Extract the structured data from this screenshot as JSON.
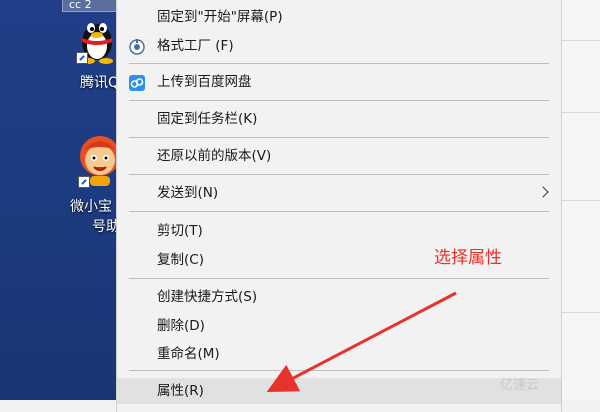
{
  "desktop": {
    "tab_text": "cc 2",
    "icons": [
      {
        "name": "qq",
        "label": "腾讯Q"
      },
      {
        "name": "weixiaobao",
        "label_line1": "微小宝",
        "label_line2": "号助"
      }
    ]
  },
  "menu": {
    "items": [
      {
        "id": "pin-start",
        "label": "固定到\"开始\"屏幕(P)"
      },
      {
        "id": "format-factory",
        "label": "格式工厂 (F)",
        "icon": "format-factory-icon"
      },
      {
        "id": "upload-baidu",
        "label": "上传到百度网盘",
        "icon": "baidu-netdisk-icon"
      },
      {
        "id": "pin-taskbar",
        "label": "固定到任务栏(K)"
      },
      {
        "id": "restore-versions",
        "label": "还原以前的版本(V)"
      },
      {
        "id": "send-to",
        "label": "发送到(N)",
        "submenu": true
      },
      {
        "id": "cut",
        "label": "剪切(T)"
      },
      {
        "id": "copy",
        "label": "复制(C)"
      },
      {
        "id": "create-shortcut",
        "label": "创建快捷方式(S)"
      },
      {
        "id": "delete",
        "label": "删除(D)"
      },
      {
        "id": "rename",
        "label": "重命名(M)"
      },
      {
        "id": "properties",
        "label": "属性(R)",
        "highlighted": true
      }
    ]
  },
  "annotation": {
    "text": "选择属性",
    "color": "#e8322c"
  },
  "watermark": "亿速云"
}
